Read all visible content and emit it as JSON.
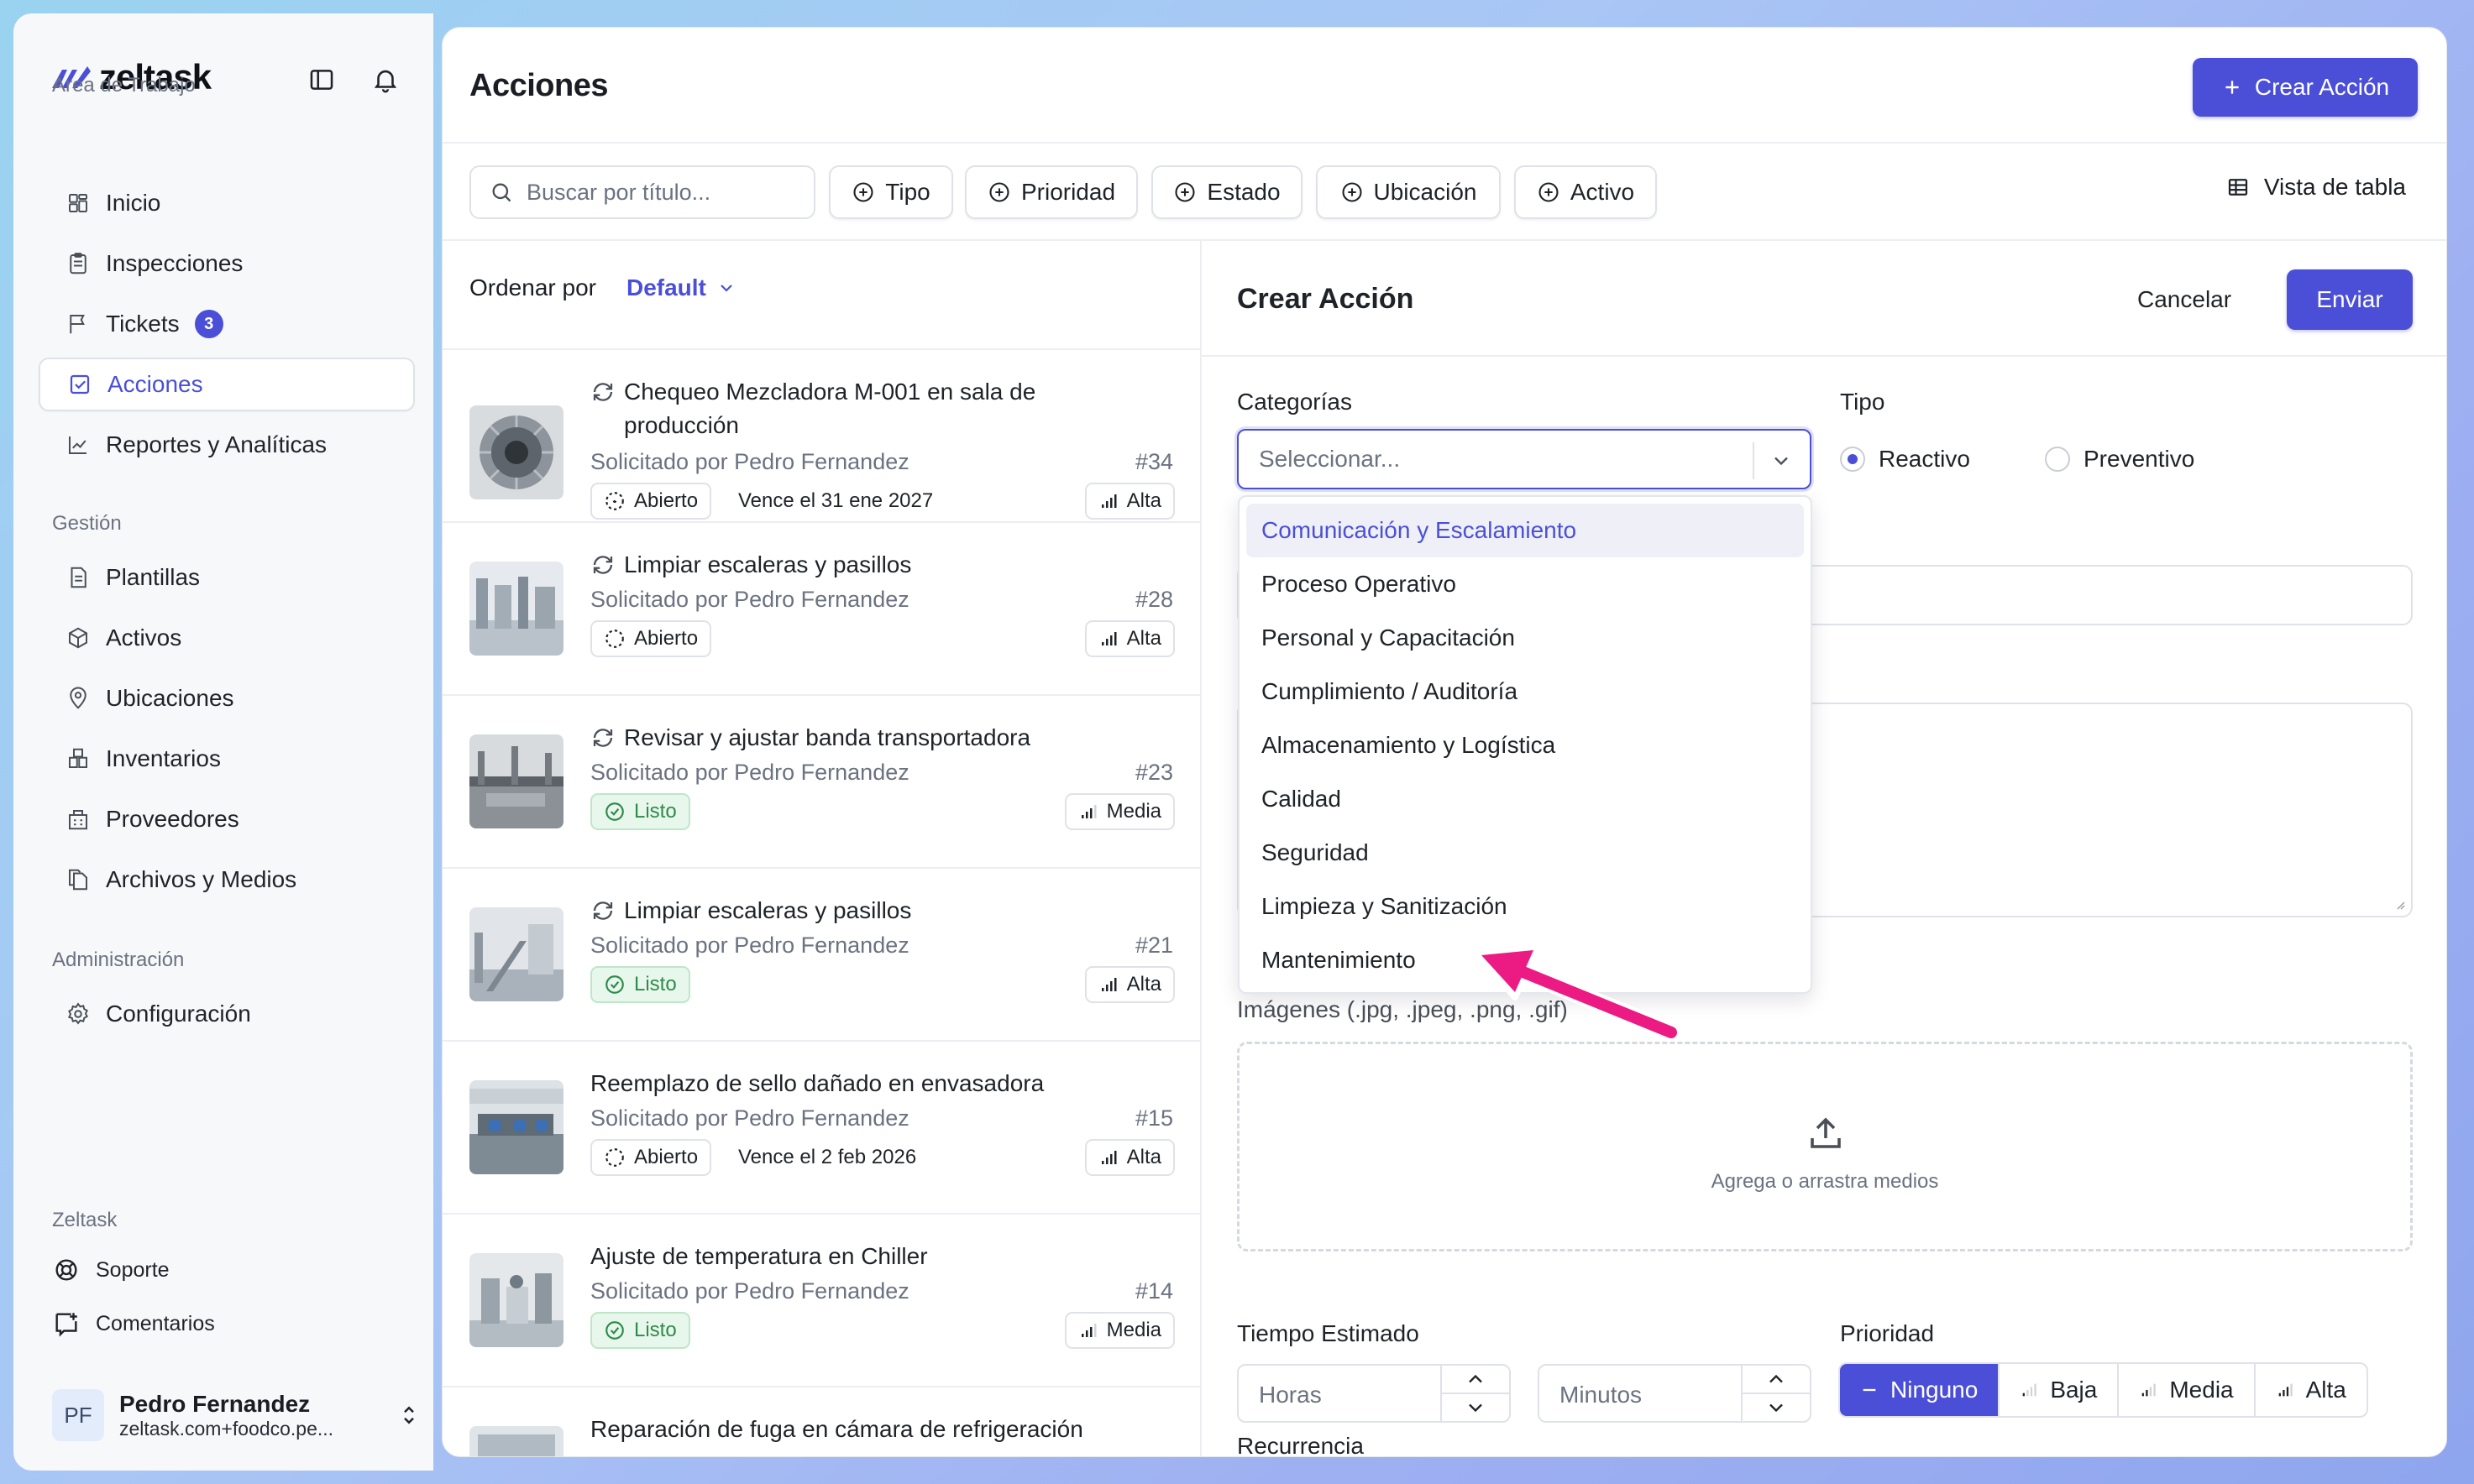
{
  "app": {
    "name": "zeltask"
  },
  "sidebar": {
    "section_workspace": "Area de Trabajo",
    "items_workspace": [
      {
        "label": "Inicio",
        "icon": "grid-icon"
      },
      {
        "label": "Inspecciones",
        "icon": "clipboard-icon"
      },
      {
        "label": "Tickets",
        "icon": "flag-icon",
        "badge": "3"
      },
      {
        "label": "Acciones",
        "icon": "checkbox-icon",
        "active": true
      },
      {
        "label": "Reportes y Analíticas",
        "icon": "chart-icon"
      }
    ],
    "section_management": "Gestión",
    "items_management": [
      {
        "label": "Plantillas",
        "icon": "document-icon"
      },
      {
        "label": "Activos",
        "icon": "cube-icon"
      },
      {
        "label": "Ubicaciones",
        "icon": "pin-icon"
      },
      {
        "label": "Inventarios",
        "icon": "inventory-icon"
      },
      {
        "label": "Proveedores",
        "icon": "building-icon"
      },
      {
        "label": "Archivos y Medios",
        "icon": "files-icon"
      }
    ],
    "section_admin": "Administración",
    "items_admin": [
      {
        "label": "Configuración",
        "icon": "gear-icon"
      }
    ],
    "section_zeltask": "Zeltask",
    "items_zeltask": [
      {
        "label": "Soporte",
        "icon": "lifebuoy-icon"
      },
      {
        "label": "Comentarios",
        "icon": "comment-icon"
      }
    ],
    "user": {
      "initials": "PF",
      "name": "Pedro Fernandez",
      "email": "zeltask.com+foodco.pe..."
    }
  },
  "header": {
    "title": "Acciones",
    "create_button": "Crear Acción",
    "search_placeholder": "Buscar por título...",
    "filters": [
      "Tipo",
      "Prioridad",
      "Estado",
      "Ubicación",
      "Activo"
    ],
    "view_toggle": "Vista de tabla"
  },
  "list": {
    "sort_label": "Ordenar por",
    "sort_value": "Default",
    "cards": [
      {
        "title": "Chequeo Mezcladora M-001 en sala de producción",
        "recurring": true,
        "requested": "Solicitado por Pedro Fernandez",
        "number": "#34",
        "status": "Abierto",
        "due": "Vence el 31 ene 2027",
        "priority": "Alta"
      },
      {
        "title": "Limpiar escaleras y pasillos",
        "recurring": true,
        "requested": "Solicitado por Pedro Fernandez",
        "number": "#28",
        "status": "Abierto",
        "due": "",
        "priority": "Alta"
      },
      {
        "title": "Revisar y ajustar banda transportadora",
        "recurring": true,
        "requested": "Solicitado por Pedro Fernandez",
        "number": "#23",
        "status": "Listo",
        "due": "",
        "priority": "Media"
      },
      {
        "title": "Limpiar escaleras y pasillos",
        "recurring": true,
        "requested": "Solicitado por Pedro Fernandez",
        "number": "#21",
        "status": "Listo",
        "due": "",
        "priority": "Alta"
      },
      {
        "title": "Reemplazo de sello dañado en envasadora",
        "recurring": false,
        "requested": "Solicitado por Pedro Fernandez",
        "number": "#15",
        "status": "Abierto",
        "due": "Vence el 2 feb 2026",
        "priority": "Alta"
      },
      {
        "title": "Ajuste de temperatura en Chiller",
        "recurring": false,
        "requested": "Solicitado por Pedro Fernandez",
        "number": "#14",
        "status": "Listo",
        "due": "",
        "priority": "Media"
      },
      {
        "title": "Reparación de fuga en cámara de refrigeración",
        "recurring": false,
        "requested": "",
        "number": "",
        "status": "",
        "due": "",
        "priority": ""
      }
    ]
  },
  "form": {
    "title": "Crear Acción",
    "cancel": "Cancelar",
    "submit": "Enviar",
    "categories_label": "Categorías",
    "categories_placeholder": "Seleccionar...",
    "type_label": "Tipo",
    "type_options": [
      "Reactivo",
      "Preventivo"
    ],
    "type_selected": "Reactivo",
    "images_label": "Imágenes (.jpg, .jpeg, .png, .gif)",
    "dropzone_text": "Agrega o arrastra medios",
    "time_label": "Tiempo Estimado",
    "hours_placeholder": "Horas",
    "minutes_placeholder": "Minutos",
    "priority_label": "Prioridad",
    "priority_options": [
      "Ninguno",
      "Baja",
      "Media",
      "Alta"
    ],
    "priority_selected": "Ninguno",
    "recurrence_label": "Recurrencia"
  },
  "dropdown": {
    "options": [
      "Comunicación y Escalamiento",
      "Proceso Operativo",
      "Personal y Capacitación",
      "Cumplimiento / Auditoría",
      "Almacenamiento y Logística",
      "Calidad",
      "Seguridad",
      "Limpieza y Sanitización",
      "Mantenimiento"
    ],
    "highlighted": "Comunicación y Escalamiento"
  },
  "colors": {
    "accent": "#4b4fd8",
    "annotation_arrow": "#ec1a83",
    "success": "#2e8b4a"
  }
}
